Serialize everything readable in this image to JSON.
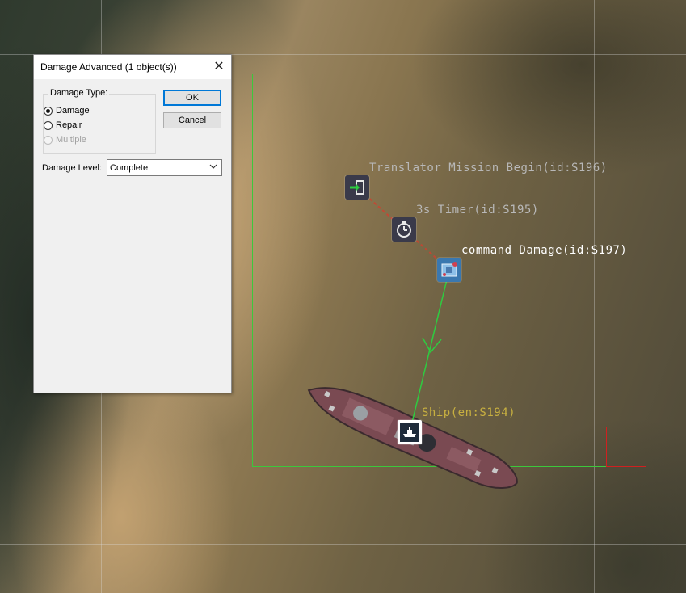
{
  "dialog": {
    "title": "Damage Advanced (1 object(s))",
    "close_glyph": "✕",
    "damage_type": {
      "legend": "Damage Type:",
      "options": [
        {
          "label": "Damage",
          "checked": true,
          "enabled": true
        },
        {
          "label": "Repair",
          "checked": false,
          "enabled": true
        },
        {
          "label": "Multiple",
          "checked": false,
          "enabled": false
        }
      ]
    },
    "ok_label": "OK",
    "cancel_label": "Cancel",
    "damage_level": {
      "label": "Damage Level:",
      "selected": "Complete"
    }
  },
  "map": {
    "nodes": {
      "mission_begin": {
        "label": "Translator Mission Begin(id:S196)",
        "icon": "enter-icon"
      },
      "timer": {
        "label": "3s Timer(id:S195)",
        "icon": "stopwatch-icon"
      },
      "command": {
        "label": "command Damage(id:S197)",
        "icon": "command-icon"
      },
      "ship": {
        "label": "Ship(en:S194)",
        "icon": "ship-icon"
      }
    },
    "colors": {
      "area_border": "#3cc83c",
      "link_line": "#2ecc40",
      "event_link": "#d04030",
      "selection_box": "#d02020",
      "label_dim": "#b8b8b8",
      "label_bright": "#ffffff",
      "label_ship": "#c8b040"
    }
  }
}
